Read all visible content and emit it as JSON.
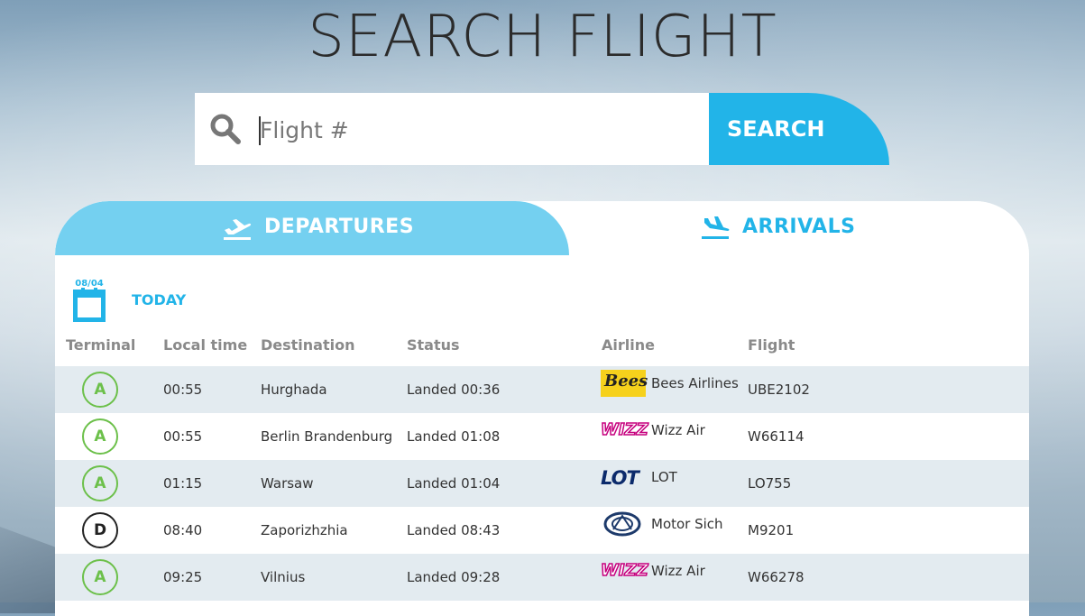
{
  "page": {
    "title": "SEARCH FLIGHT"
  },
  "search": {
    "placeholder": "Flight #",
    "button_label": "SEARCH",
    "icon": "search-icon"
  },
  "tabs": [
    {
      "label": "DEPARTURES",
      "icon": "plane-takeoff-icon",
      "active": true
    },
    {
      "label": "ARRIVALS",
      "icon": "plane-landing-icon",
      "active": false
    }
  ],
  "date": {
    "badge": "08/04",
    "label": "TODAY",
    "icon": "calendar-icon"
  },
  "columns": [
    "Terminal",
    "Local time",
    "Destination",
    "Status",
    "Airline",
    "Flight"
  ],
  "flights": [
    {
      "terminal": "A",
      "time": "00:55",
      "destination": "Hurghada",
      "status": "Landed 00:36",
      "airline": "Bees Airlines",
      "flight": "UBE2102",
      "logo": "bees-logo",
      "logo_text": "Bees"
    },
    {
      "terminal": "A",
      "time": "00:55",
      "destination": "Berlin Brandenburg",
      "status": "Landed 01:08",
      "airline": "Wizz Air",
      "flight": "W66114",
      "logo": "wizz-logo",
      "logo_text": "WIZZ"
    },
    {
      "terminal": "A",
      "time": "01:15",
      "destination": "Warsaw",
      "status": "Landed 01:04",
      "airline": "LOT",
      "flight": "LO755",
      "logo": "lot-logo",
      "logo_text": "LOT"
    },
    {
      "terminal": "D",
      "time": "08:40",
      "destination": "Zaporizhzhia",
      "status": "Landed 08:43",
      "airline": "Motor Sich",
      "flight": "M9201",
      "logo": "motor-sich-logo",
      "logo_text": ""
    },
    {
      "terminal": "A",
      "time": "09:25",
      "destination": "Vilnius",
      "status": "Landed 09:28",
      "airline": "Wizz Air",
      "flight": "W66278",
      "logo": "wizz-logo",
      "logo_text": "WIZZ"
    }
  ],
  "colors": {
    "accent": "#22b4e8",
    "tab_active": "#74d0f0",
    "terminal_a": "#6cc04a",
    "terminal_d": "#222222",
    "row_alt": "#e3ebf0"
  }
}
